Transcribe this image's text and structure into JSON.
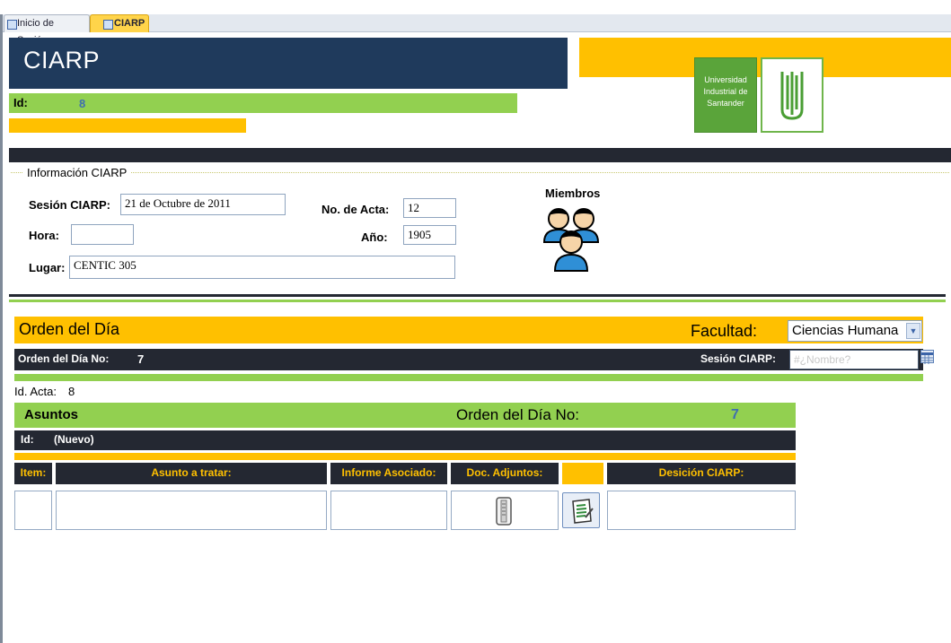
{
  "tabs": [
    {
      "label": "Inicio de Sesión"
    },
    {
      "label": "CIARP"
    }
  ],
  "header": {
    "title": "CIARP",
    "id_label": "Id:",
    "id_value": "8",
    "logo_text": "Universidad Industrial de Santander"
  },
  "info": {
    "section_label": "Información CIARP",
    "sesion_label": "Sesión CIARP:",
    "sesion_value": "21 de Octubre de 2011",
    "hora_label": "Hora:",
    "hora_value": "",
    "lugar_label": "Lugar:",
    "lugar_value": "CENTIC 305",
    "acta_label": "No. de Acta:",
    "acta_value": "12",
    "anio_label": "Año:",
    "anio_value": "1905",
    "miembros_label": "Miembros"
  },
  "orden": {
    "title": "Orden del Día",
    "facultad_label": "Facultad:",
    "facultad_value": "Ciencias Humana",
    "no_label": "Orden del Día No:",
    "no_value": "7",
    "sesion_label": "Sesión CIARP:",
    "sesion_value": "#¿Nombre?",
    "id_acta_label": "Id. Acta:",
    "id_acta_value": "8"
  },
  "asuntos": {
    "title": "Asuntos",
    "orden_label": "Orden del Día No:",
    "orden_value": "7",
    "id_label": "Id:",
    "id_value": "(Nuevo)",
    "columns": [
      "Item:",
      "Asunto a tratar:",
      "Informe Asociado:",
      "Doc. Adjuntos:",
      "",
      "Desición CIARP:"
    ]
  },
  "colors": {
    "navy": "#1f3a5c",
    "green": "#92d050",
    "yellow": "#ffc000",
    "dark": "#242832",
    "accent_blue": "#3f6fb0"
  }
}
